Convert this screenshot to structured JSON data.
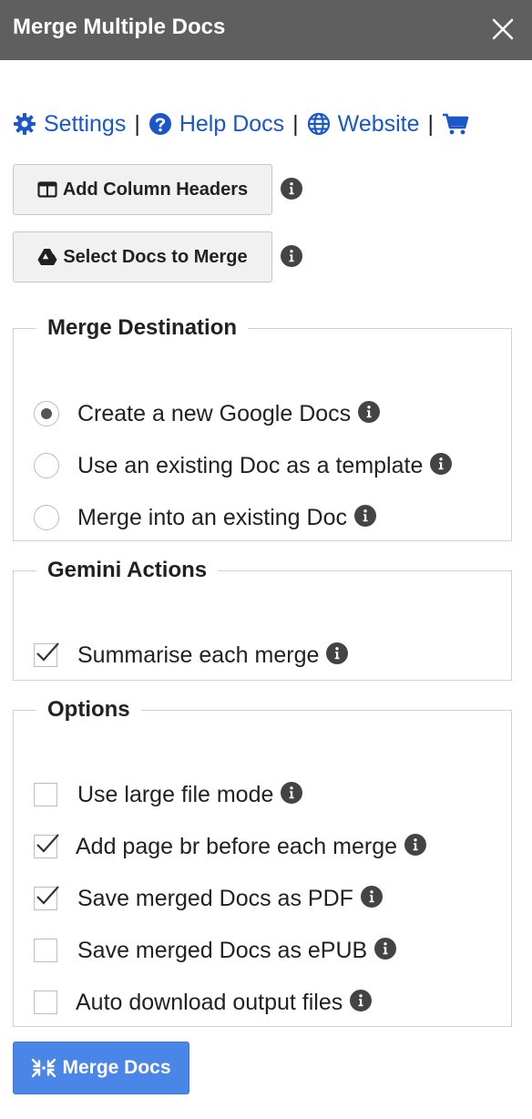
{
  "window": {
    "title": "Merge Multiple Docs"
  },
  "links": [
    {
      "label": "Settings",
      "icon": "gear-icon"
    },
    {
      "label": "Help Docs",
      "icon": "question-circle-icon"
    },
    {
      "label": "Website",
      "icon": "globe-icon"
    },
    {
      "label": "",
      "icon": "cart-icon"
    }
  ],
  "separator": "|",
  "buttons": {
    "add_headers": "Add Column Headers",
    "select_docs": "Select Docs to Merge",
    "merge": "Merge Docs"
  },
  "merge_destination": {
    "legend": "Merge Destination",
    "options": [
      {
        "label": "Create a new Google Docs",
        "selected": true
      },
      {
        "label": "Use an existing Doc as a template",
        "selected": false
      },
      {
        "label": "Merge into an existing Doc",
        "selected": false
      }
    ]
  },
  "gemini": {
    "legend": "Gemini Actions",
    "options": [
      {
        "label": "Summarise each merge",
        "checked": true
      }
    ]
  },
  "options": {
    "legend": "Options",
    "items": [
      {
        "label": "Use large file mode",
        "checked": false
      },
      {
        "label": "Add page br before each merge",
        "checked": true
      },
      {
        "label": "Save merged Docs as PDF",
        "checked": true
      },
      {
        "label": "Save merged Docs as ePUB",
        "checked": false
      },
      {
        "label": "Auto download output files",
        "checked": false
      }
    ]
  },
  "colors": {
    "titlebar": "#5f5f5f",
    "link": "#1a57c9",
    "primary_button": "#4a86e8"
  }
}
